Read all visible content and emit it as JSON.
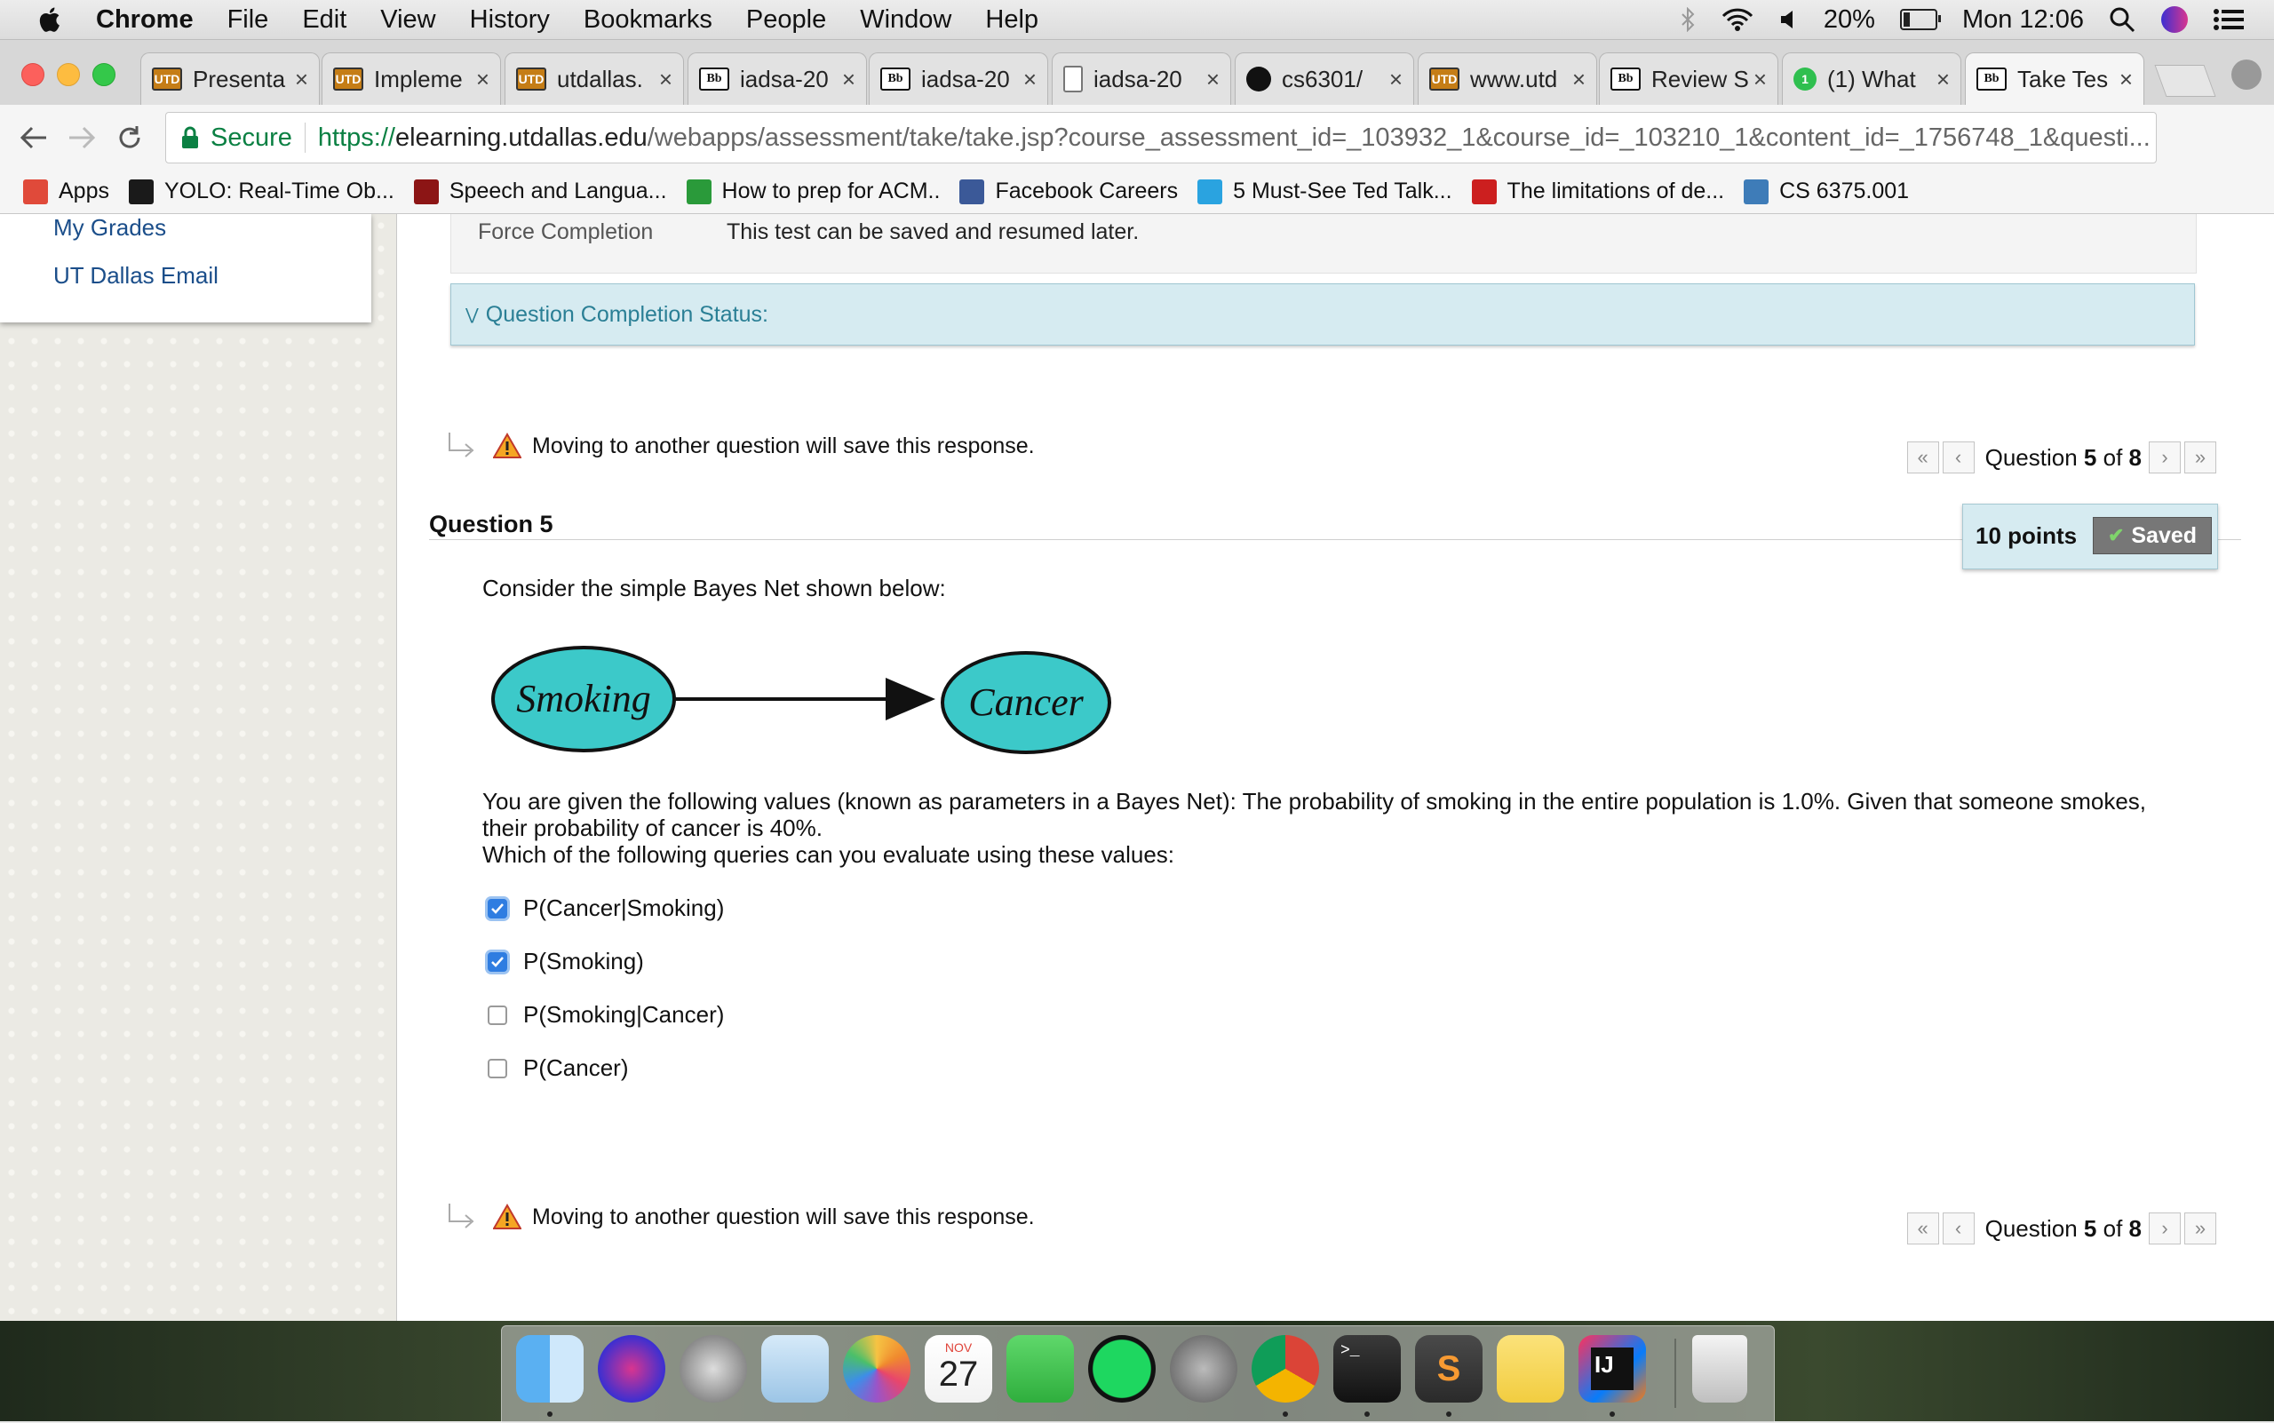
{
  "menubar": {
    "app": "Chrome",
    "items": [
      "File",
      "Edit",
      "View",
      "History",
      "Bookmarks",
      "People",
      "Window",
      "Help"
    ],
    "battery": "20%",
    "battery_level": 0.2,
    "clock": "Mon 12:06"
  },
  "tabs": [
    {
      "label": "Presenta",
      "icon": "utd"
    },
    {
      "label": "Impleme",
      "icon": "utd"
    },
    {
      "label": "utdallas.",
      "icon": "utd"
    },
    {
      "label": "iadsa-20",
      "icon": "bb"
    },
    {
      "label": "iadsa-20",
      "icon": "bb"
    },
    {
      "label": "iadsa-20",
      "icon": "doc"
    },
    {
      "label": "cs6301/",
      "icon": "github"
    },
    {
      "label": "www.utd",
      "icon": "utd"
    },
    {
      "label": "Review S",
      "icon": "bb"
    },
    {
      "label": "(1) What",
      "icon": "whatsapp"
    },
    {
      "label": "Take Tes",
      "icon": "bb",
      "active": true
    }
  ],
  "toolbar": {
    "secure_label": "Secure",
    "url_scheme": "https://",
    "url_host": "elearning.utdallas.edu",
    "url_rest": "/webapps/assessment/take/take.jsp?course_assessment_id=_103932_1&course_id=_103210_1&content_id=_1756748_1&questi..."
  },
  "bookmarks": [
    {
      "label": "Apps",
      "icon": "apps-grid-icon",
      "color": "#e04a3a"
    },
    {
      "label": "YOLO: Real-Time Ob...",
      "icon": "yolo-icon",
      "color": "#1a1a1a"
    },
    {
      "label": "Speech and Langua...",
      "icon": "stanford-icon",
      "color": "#8c1515"
    },
    {
      "label": "How to prep for ACM..",
      "icon": "acm-icon",
      "color": "#2a9a3a"
    },
    {
      "label": "Facebook Careers",
      "icon": "facebook-icon",
      "color": "#3b5998"
    },
    {
      "label": "5 Must-See Ted Talk...",
      "icon": "cloud-icon",
      "color": "#2aa3e0"
    },
    {
      "label": "The limitations of de...",
      "icon": "k-icon",
      "color": "#cc1f1f"
    },
    {
      "label": "CS 6375.001",
      "icon": "piazza-icon",
      "color": "#3e7cb8"
    }
  ],
  "sidebar": {
    "links": [
      "My Grades",
      "UT Dallas Email"
    ]
  },
  "test_info": {
    "force_completion_label": "Force Completion",
    "force_completion_value": "This test can be saved and resumed later."
  },
  "completion_status": "Question Completion Status:",
  "save_note": "Moving to another question will save this response.",
  "question_nav": {
    "prefix": "Question",
    "current": "5",
    "of": "of",
    "total": "8"
  },
  "question": {
    "title": "Question 5",
    "points": "10 points",
    "saved_label": "Saved",
    "intro": "Consider the simple Bayes Net shown below:",
    "node_a": "Smoking",
    "node_b": "Cancer",
    "paragraph_1": "You are given the following values (known as parameters in a Bayes Net): The probability of smoking in the entire population is 1.0%. Given that someone smokes, their probability of cancer is 40%.",
    "paragraph_2": "Which of the following queries can you evaluate using these values:",
    "answers": [
      {
        "label": "P(Cancer|Smoking)",
        "checked": true
      },
      {
        "label": "P(Smoking)",
        "checked": true
      },
      {
        "label": "P(Smoking|Cancer)",
        "checked": false
      },
      {
        "label": "P(Cancer)",
        "checked": false
      }
    ]
  },
  "dock": {
    "apps": [
      "finder",
      "siri",
      "launchpad",
      "mail",
      "photos",
      "calendar",
      "facetime",
      "spotify",
      "system-preferences",
      "chrome",
      "terminal",
      "sublime-text",
      "stickies",
      "intellij"
    ],
    "calendar_month": "NOV",
    "calendar_day": "27"
  }
}
